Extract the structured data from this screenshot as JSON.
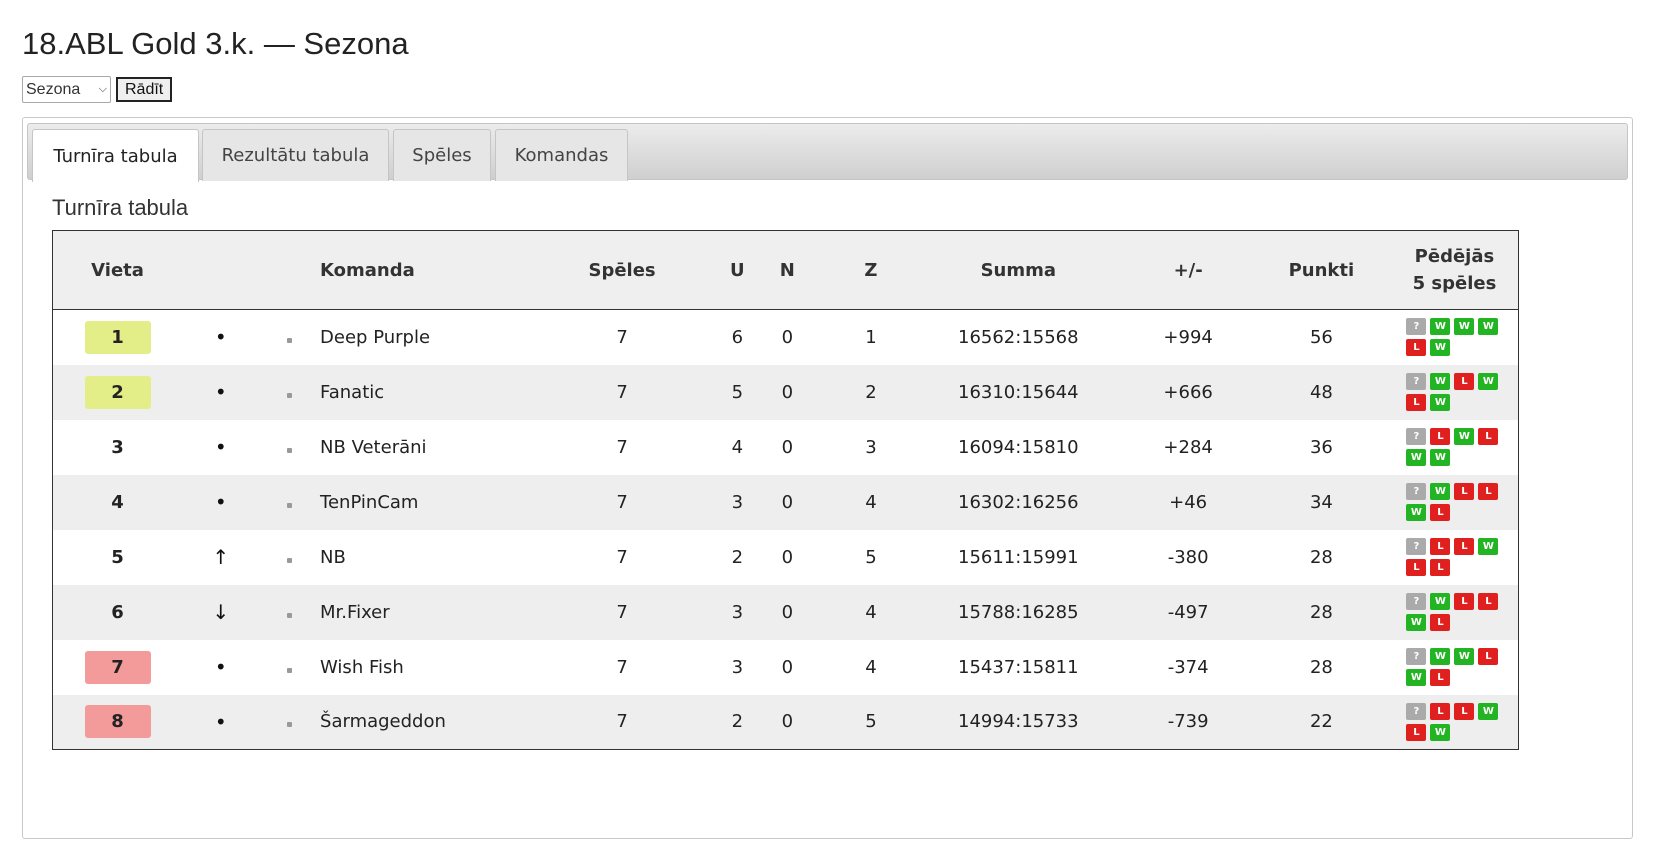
{
  "page": {
    "title": "18.ABL Gold 3.k. — Sezona"
  },
  "controls": {
    "season_value": "Sezona",
    "show_label": "Rādīt"
  },
  "tabs": [
    {
      "label": "Turnīra tabula",
      "active": true
    },
    {
      "label": "Rezultātu tabula",
      "active": false
    },
    {
      "label": "Spēles",
      "active": false
    },
    {
      "label": "Komandas",
      "active": false
    }
  ],
  "section": {
    "title": "Turnīra tabula"
  },
  "table": {
    "headers": {
      "place": "Vieta",
      "team": "Komanda",
      "games": "Spēles",
      "wins": "U",
      "draws": "N",
      "losses": "Z",
      "sum": "Summa",
      "diff": "+/-",
      "points": "Punkti",
      "last5_line1": "Pēdējās",
      "last5_line2": "5 spēles"
    },
    "rows": [
      {
        "place": "1",
        "zone": "promo",
        "trend": "•",
        "team": "Deep Purple",
        "games": "7",
        "wins": "6",
        "draws": "0",
        "losses": "1",
        "sum": "16562:15568",
        "diff": "+994",
        "points": "56",
        "last5": [
          "?",
          "W",
          "W",
          "W",
          "L",
          "W"
        ]
      },
      {
        "place": "2",
        "zone": "promo",
        "trend": "•",
        "team": "Fanatic",
        "games": "7",
        "wins": "5",
        "draws": "0",
        "losses": "2",
        "sum": "16310:15644",
        "diff": "+666",
        "points": "48",
        "last5": [
          "?",
          "W",
          "L",
          "W",
          "L",
          "W"
        ]
      },
      {
        "place": "3",
        "zone": "",
        "trend": "•",
        "team": "NB Veterāni",
        "games": "7",
        "wins": "4",
        "draws": "0",
        "losses": "3",
        "sum": "16094:15810",
        "diff": "+284",
        "points": "36",
        "last5": [
          "?",
          "L",
          "W",
          "L",
          "W",
          "W"
        ]
      },
      {
        "place": "4",
        "zone": "",
        "trend": "•",
        "team": "TenPinCam",
        "games": "7",
        "wins": "3",
        "draws": "0",
        "losses": "4",
        "sum": "16302:16256",
        "diff": "+46",
        "points": "34",
        "last5": [
          "?",
          "W",
          "L",
          "L",
          "W",
          "L"
        ]
      },
      {
        "place": "5",
        "zone": "",
        "trend": "↑",
        "team": "NB",
        "games": "7",
        "wins": "2",
        "draws": "0",
        "losses": "5",
        "sum": "15611:15991",
        "diff": "-380",
        "points": "28",
        "last5": [
          "?",
          "L",
          "L",
          "W",
          "L",
          "L"
        ]
      },
      {
        "place": "6",
        "zone": "",
        "trend": "↓",
        "team": "Mr.Fixer",
        "games": "7",
        "wins": "3",
        "draws": "0",
        "losses": "4",
        "sum": "15788:16285",
        "diff": "-497",
        "points": "28",
        "last5": [
          "?",
          "W",
          "L",
          "L",
          "W",
          "L"
        ]
      },
      {
        "place": "7",
        "zone": "releg",
        "trend": "•",
        "team": "Wish Fish",
        "games": "7",
        "wins": "3",
        "draws": "0",
        "losses": "4",
        "sum": "15437:15811",
        "diff": "-374",
        "points": "28",
        "last5": [
          "?",
          "W",
          "W",
          "L",
          "W",
          "L"
        ]
      },
      {
        "place": "8",
        "zone": "releg",
        "trend": "•",
        "team": "Šarmageddon",
        "games": "7",
        "wins": "2",
        "draws": "0",
        "losses": "5",
        "sum": "14994:15733",
        "diff": "-739",
        "points": "22",
        "last5": [
          "?",
          "L",
          "L",
          "W",
          "L",
          "W"
        ]
      }
    ]
  },
  "colors": {
    "promo": "#e4ee88",
    "releg": "#f39a9a",
    "win": "#22b422",
    "loss": "#e01f1f",
    "unknown": "#aaaaaa"
  }
}
